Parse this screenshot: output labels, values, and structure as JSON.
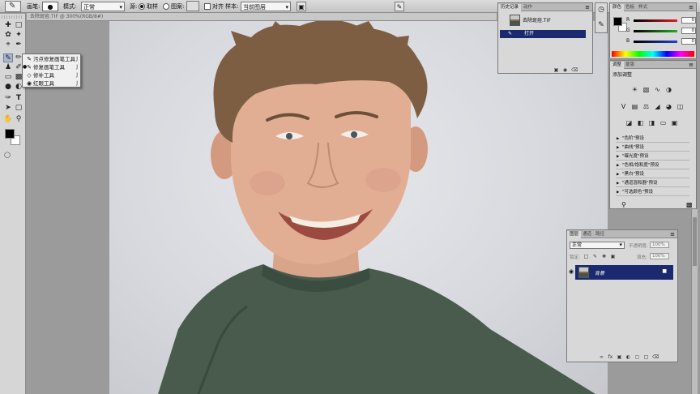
{
  "options_bar": {
    "brush_label": "画笔:",
    "mode_label": "模式:",
    "mode_value": "正常",
    "source_label": "源:",
    "sampled_label": "取样",
    "pattern_label": "图案:",
    "aligned_label": "对齐",
    "sample_label": "样本:",
    "sample_value": "当前图层"
  },
  "document": {
    "title": "去除斑痘.TIF @ 300%(RGB/8#)"
  },
  "tool_flyout": {
    "items": [
      {
        "label": "污点修复画笔工具",
        "key": "J",
        "icon": "spot-healing-icon",
        "selected": false
      },
      {
        "label": "修复画笔工具",
        "key": "J",
        "icon": "healing-brush-icon",
        "selected": true
      },
      {
        "label": "修补工具",
        "key": "J",
        "icon": "patch-icon",
        "selected": false
      },
      {
        "label": "红眼工具",
        "key": "J",
        "icon": "red-eye-icon",
        "selected": false
      }
    ]
  },
  "history_panel": {
    "tabs": [
      "历史记录",
      "动作"
    ],
    "snapshot_label": "去除斑痘.TIF",
    "states": [
      "打开"
    ]
  },
  "color_panel": {
    "tabs": [
      "颜色",
      "色板",
      "样式"
    ],
    "channels": [
      {
        "label": "R",
        "value": "0",
        "track": "#e02020"
      },
      {
        "label": "G",
        "value": "0",
        "track": "#20b020"
      },
      {
        "label": "B",
        "value": "0",
        "track": "#2040e0"
      }
    ]
  },
  "adjustments_panel": {
    "tabs": [
      "调整",
      "蒙版"
    ],
    "title": "添加调整",
    "presets": [
      "\"色阶\"预设",
      "\"曲线\"预设",
      "\"曝光度\"预设",
      "\"色相/饱和度\"预设",
      "\"黑白\"预设",
      "\"通道混和器\"预设",
      "\"可选颜色\"预设"
    ]
  },
  "layers_panel": {
    "tabs": [
      "图层",
      "通道",
      "路径"
    ],
    "blend_mode": "正常",
    "opacity_label": "不透明度:",
    "opacity_value": "100%",
    "lock_label": "锁定:",
    "fill_label": "填充:",
    "fill_value": "100%",
    "layers": [
      {
        "name": "背景",
        "visible": true,
        "selected": true
      }
    ]
  },
  "colors": {
    "selection": "#1b2a6e",
    "panel_bg": "#d8d8d8",
    "workspace": "#9b9b9b"
  }
}
